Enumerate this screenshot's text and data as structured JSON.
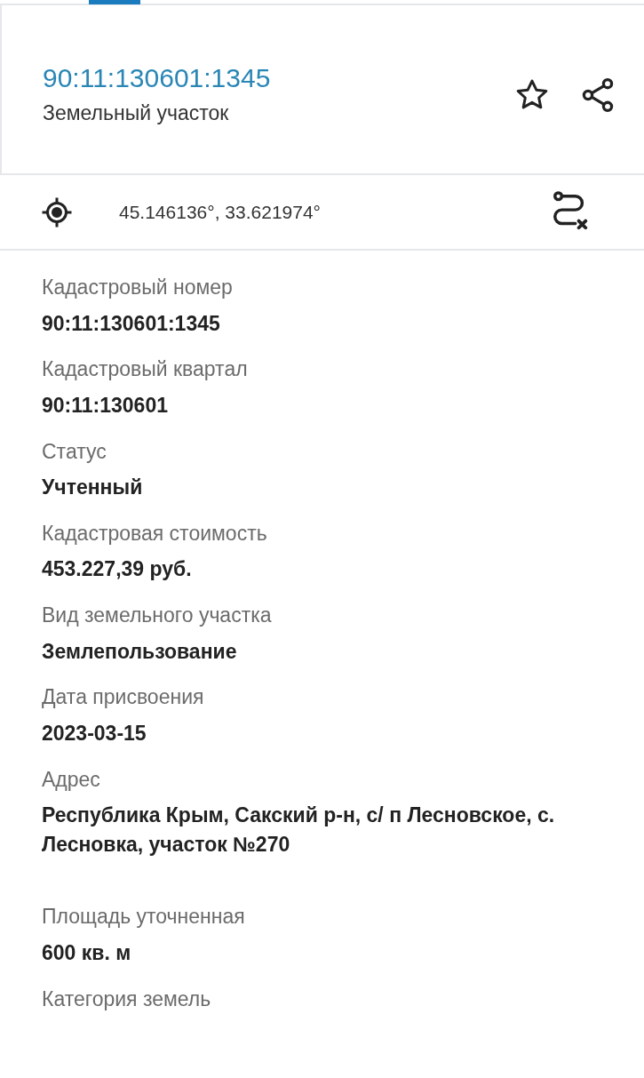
{
  "header": {
    "title": "90:11:130601:1345",
    "subtitle": "Земельный участок"
  },
  "coordinates": "45.146136°, 33.621974°",
  "fields": [
    {
      "label": "Кадастровый номер",
      "value": "90:11:130601:1345"
    },
    {
      "label": "Кадастровый квартал",
      "value": "90:11:130601"
    },
    {
      "label": "Статус",
      "value": "Учтенный"
    },
    {
      "label": "Кадастровая стоимость",
      "value": "453.227,39 руб."
    },
    {
      "label": "Вид земельного участка",
      "value": "Землепользование"
    },
    {
      "label": "Дата присвоения",
      "value": "2023-03-15"
    },
    {
      "label": "Адрес",
      "value": "Республика Крым, Сакский р-н, с/ п Лесновское, с. Лесновка, участок №270"
    },
    {
      "label": "Площадь уточненная",
      "value": "600 кв. м"
    },
    {
      "label": "Категория земель"
    }
  ]
}
